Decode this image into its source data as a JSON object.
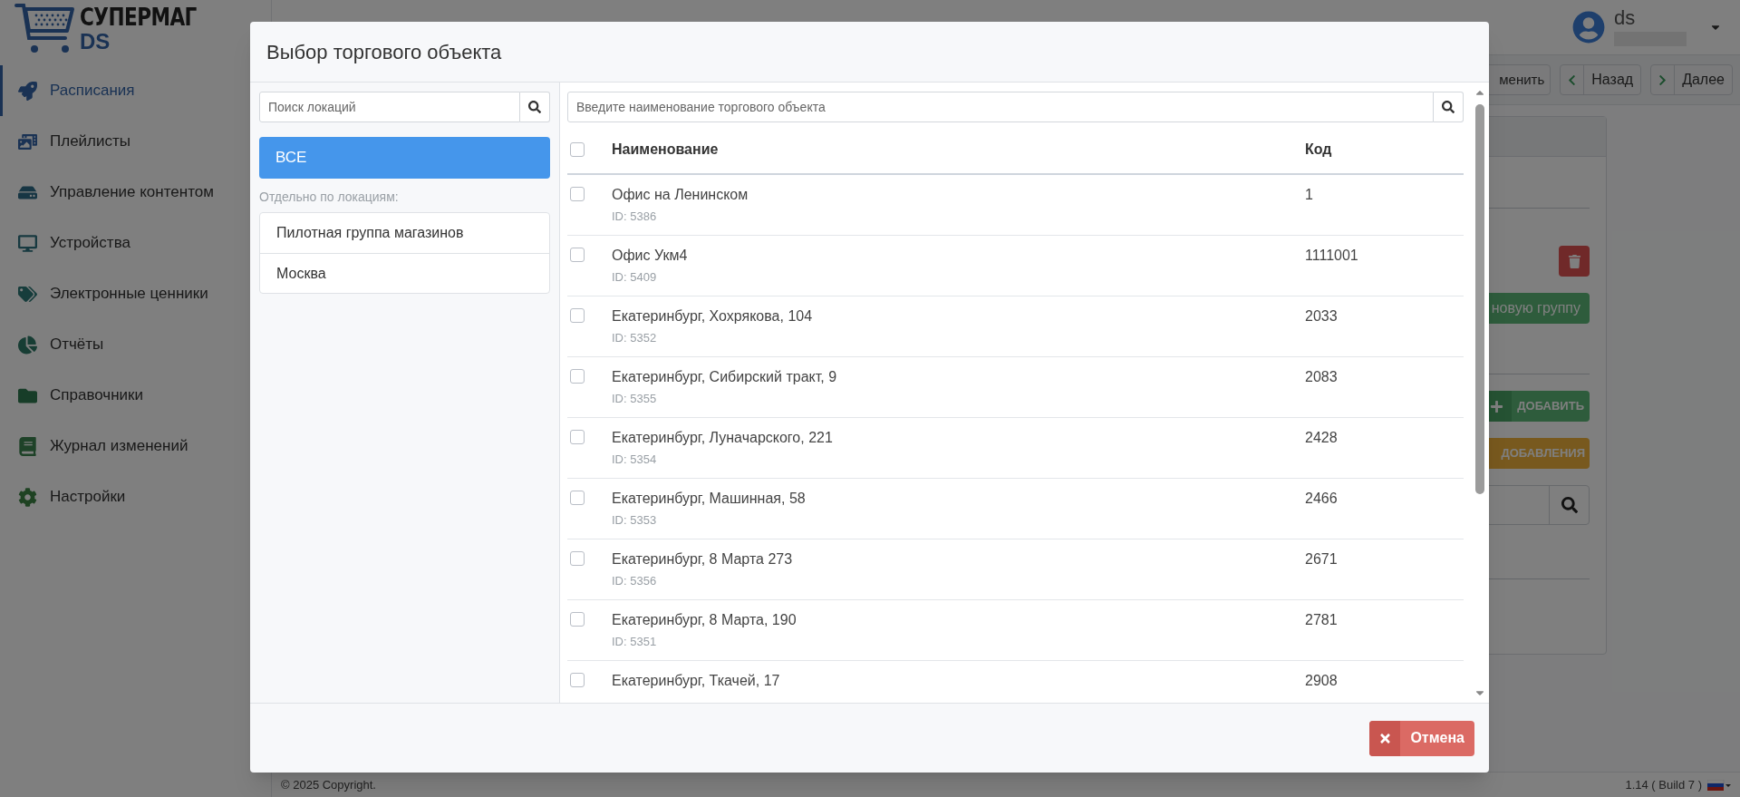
{
  "app": {
    "logo": {
      "title": "СУПЕРМАГ",
      "subtitle": "DS"
    },
    "user": {
      "name": "ds"
    }
  },
  "sidebar": {
    "items": [
      {
        "label": "Расписания",
        "selected": true
      },
      {
        "label": "Плейлисты",
        "selected": false
      },
      {
        "label": "Управление контентом",
        "selected": false
      },
      {
        "label": "Устройства",
        "selected": false
      },
      {
        "label": "Электронные ценники",
        "selected": false
      },
      {
        "label": "Отчёты",
        "selected": false
      },
      {
        "label": "Справочники",
        "selected": false
      },
      {
        "label": "Журнал изменений",
        "selected": false
      },
      {
        "label": "Настройки",
        "selected": false
      }
    ]
  },
  "toolbar": {
    "buttons": [
      {
        "kind": "plain",
        "label": "менить"
      },
      {
        "kind": "back",
        "label": "Назад"
      },
      {
        "kind": "next",
        "label": "Далее"
      }
    ]
  },
  "panel": {
    "group_button": "новую группу",
    "add_button": "ДОБАВИТЬ",
    "auto_button": "ДОБАВЛЕНИЯ"
  },
  "footer": {
    "copyright": "© 2025 Copyright.",
    "version": "1.14 ( Build 7 )"
  },
  "modal": {
    "title": "Выбор торгового объекта",
    "locations": {
      "search_placeholder": "Поиск локаций",
      "all_button": {
        "label": "ВСЕ",
        "selected": true
      },
      "section_label": "Отдельно по локациям:",
      "items": [
        {
          "label": "Пилотная группа магазинов",
          "selected": false
        },
        {
          "label": "Москва",
          "selected": false
        }
      ]
    },
    "objects": {
      "search_placeholder": "Введите наименование торгового объекта",
      "columns": [
        "Наименование",
        "Код"
      ],
      "select_all_checked": false,
      "rows": [
        {
          "name": "Офис на Ленинском",
          "id": "ID: 5386",
          "code": "1",
          "checked": false
        },
        {
          "name": "Офис Укм4",
          "id": "ID: 5409",
          "code": "1111001",
          "checked": false
        },
        {
          "name": "Екатеринбург, Хохрякова, 104",
          "id": "ID: 5352",
          "code": "2033",
          "checked": false
        },
        {
          "name": "Екатеринбург, Сибирский тракт, 9",
          "id": "ID: 5355",
          "code": "2083",
          "checked": false
        },
        {
          "name": "Екатеринбург, Луначарского, 221",
          "id": "ID: 5354",
          "code": "2428",
          "checked": false
        },
        {
          "name": "Екатеринбург, Машинная, 58",
          "id": "ID: 5353",
          "code": "2466",
          "checked": false
        },
        {
          "name": "Екатеринбург, 8 Марта 273",
          "id": "ID: 5356",
          "code": "2671",
          "checked": false
        },
        {
          "name": "Екатеринбург, 8 Марта, 190",
          "id": "ID: 5351",
          "code": "2781",
          "checked": false
        },
        {
          "name": "Екатеринбург, Ткачей, 17",
          "code": "2908",
          "checked": false
        }
      ]
    },
    "cancel_button": "Отмена"
  }
}
